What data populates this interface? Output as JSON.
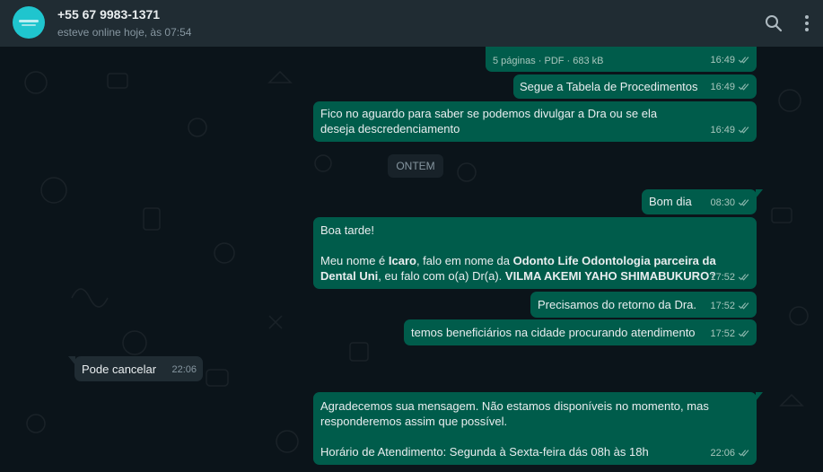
{
  "header": {
    "contact_name": "+55 67 9983-1371",
    "contact_status": "esteve online hoje, às 07:54"
  },
  "icons": {
    "search": "search-icon",
    "menu": "kebab-menu-icon",
    "read_receipt": "double-check-icon"
  },
  "colors": {
    "outgoing_bubble": "#005c4b",
    "incoming_bubble": "#202c33",
    "header": "#202c33",
    "background": "#0b141a",
    "read_tick": "#8bb7ad"
  },
  "messages": {
    "doc": {
      "info": "5 páginas · PDF · 683 kB",
      "time": "16:49"
    },
    "m1": {
      "text": "Segue a Tabela de Procedimentos",
      "time": "16:49"
    },
    "m2": {
      "text": "Fico no aguardo para saber se podemos divulgar a Dra ou se ela deseja descredenciamento",
      "time": "16:49"
    },
    "date_divider": "ONTEM",
    "m3": {
      "text": "Bom dia",
      "time": "08:30"
    },
    "m4": {
      "greeting": "Boa tarde!",
      "p1": "Meu nome é ",
      "name": "Icaro",
      "p2": ", falo em nome da ",
      "company": "Odonto Life Odontologia parceira da Dental Uni",
      "p3": ", eu falo com o(a) Dr(a). ",
      "doctor": "VILMA AKEMI YAHO SHIMABUKURO",
      "p4": "?",
      "time": "17:52"
    },
    "m5": {
      "text": "Precisamos do retorno da Dra.",
      "time": "17:52"
    },
    "m6": {
      "text": "temos beneficiários na cidade procurando atendimento",
      "time": "17:52"
    },
    "m7": {
      "text": "Pode cancelar",
      "time": "22:06"
    },
    "m8": {
      "line1": "Agradecemos sua mensagem. Não estamos disponíveis no momento, mas responderemos assim que possível.",
      "line2": "Horário de Atendimento: Segunda à Sexta-feira dás 08h às 18h",
      "time": "22:06"
    }
  }
}
